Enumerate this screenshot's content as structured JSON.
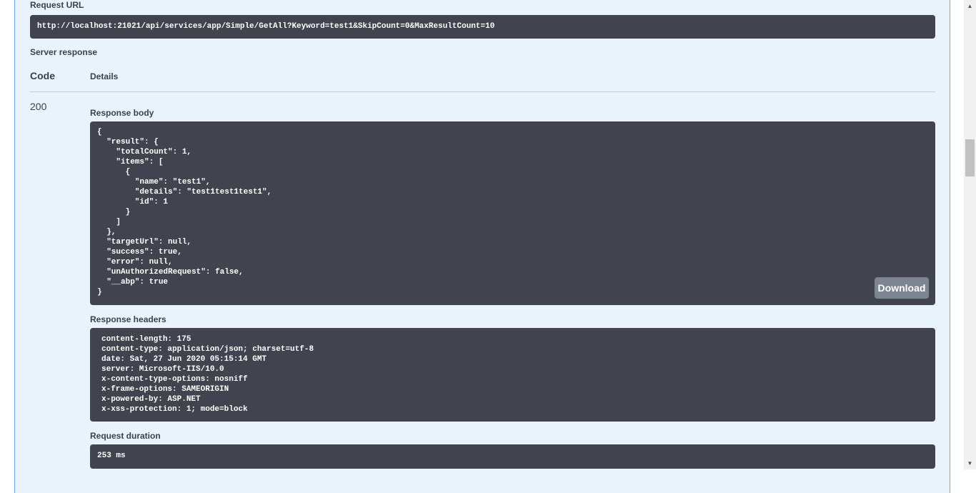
{
  "request_url": {
    "label": "Request URL",
    "value": "http://localhost:21021/api/services/app/Simple/GetAll?Keyword=test1&SkipCount=0&MaxResultCount=10"
  },
  "server_response": {
    "label": "Server response",
    "code_header": "Code",
    "details_header": "Details",
    "status_code": "200"
  },
  "response_body": {
    "label": "Response body",
    "content": "{\n  \"result\": {\n    \"totalCount\": 1,\n    \"items\": [\n      {\n        \"name\": \"test1\",\n        \"details\": \"test1test1test1\",\n        \"id\": 1\n      }\n    ]\n  },\n  \"targetUrl\": null,\n  \"success\": true,\n  \"error\": null,\n  \"unAuthorizedRequest\": false,\n  \"__abp\": true\n}",
    "download_label": "Download"
  },
  "response_headers": {
    "label": "Response headers",
    "content": "content-length: 175\ncontent-type: application/json; charset=utf-8\ndate: Sat, 27 Jun 2020 05:15:14 GMT\nserver: Microsoft-IIS/10.0\nx-content-type-options: nosniff\nx-frame-options: SAMEORIGIN\nx-powered-by: ASP.NET\nx-xss-protection: 1; mode=block"
  },
  "request_duration": {
    "label": "Request duration",
    "value": "253 ms"
  },
  "scrollbar": {
    "up_icon": "▲",
    "down_icon": "▼"
  }
}
